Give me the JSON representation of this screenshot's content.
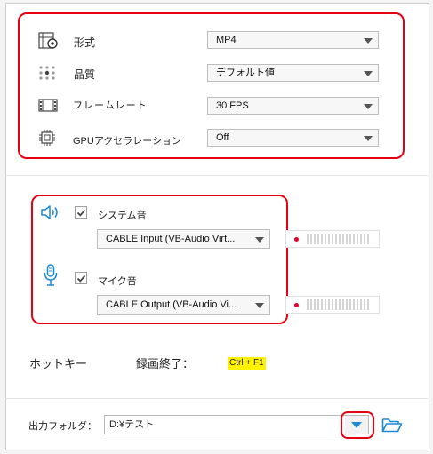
{
  "settings": {
    "format": {
      "label": "形式",
      "value": "MP4",
      "icon": "format-gear-icon"
    },
    "quality": {
      "label": "品質",
      "value": "デフォルト値",
      "icon": "quality-dots-icon"
    },
    "framerate": {
      "label": "フレームレート",
      "value": "30 FPS",
      "icon": "film-strip-icon"
    },
    "gpu": {
      "label": "GPUアクセラレーション",
      "value": "Off",
      "icon": "chip-icon"
    }
  },
  "audio": {
    "system": {
      "label": "システム音",
      "checked": true,
      "device": "CABLE Input (VB-Audio Virt...",
      "icon": "speaker-icon"
    },
    "mic": {
      "label": "マイク音",
      "checked": true,
      "device": "CABLE Output (VB-Audio Vi...",
      "icon": "microphone-icon"
    }
  },
  "hotkey": {
    "label": "ホットキー",
    "action": "録画終了：",
    "keys": "Ctrl + F1"
  },
  "output": {
    "label": "出力フォルダ：",
    "path": "D:¥テスト"
  },
  "colors": {
    "highlight": "#e60012",
    "accent": "#1c8ad6",
    "badge": "#fff200",
    "meter_dot": "#e4002b"
  }
}
